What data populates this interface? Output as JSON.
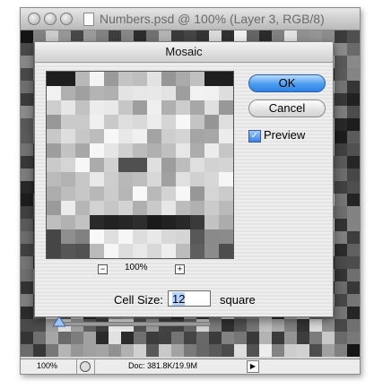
{
  "window": {
    "title": "Numbers.psd @ 100% (Layer 3, RGB/8)",
    "status_zoom": "100%",
    "status_doc": "Doc: 381.8K/19.9M"
  },
  "dialog": {
    "title": "Mosaic",
    "ok_label": "OK",
    "cancel_label": "Cancel",
    "preview_label": "Preview",
    "preview_checked": true,
    "preview_zoom": "100%",
    "cell_size_label": "Cell Size:",
    "cell_size_value": "12",
    "cell_size_unit": "square"
  },
  "icons": {
    "zoom_out": "minus-icon",
    "zoom_in": "plus-icon",
    "check": "checkmark-icon",
    "slider_thumb": "triangle-thumb-icon",
    "status_menu": "triangle-right-icon"
  },
  "colors": {
    "ok_button": "#3d8ff0",
    "window_chrome": "#d7d7d7"
  }
}
